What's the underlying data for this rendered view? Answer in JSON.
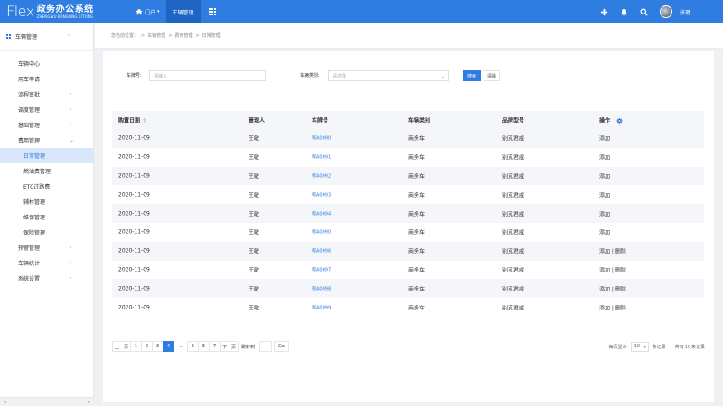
{
  "brand": {
    "mark": "Flex",
    "name_cn": "政务办公系统",
    "name_en": "ZHENGWU BANGONG XITONG"
  },
  "topnav": {
    "portal": "门户",
    "vehicle_mgmt": "车辆管理"
  },
  "user": {
    "name": "张璐"
  },
  "sidebar": {
    "header": "车辆管理",
    "items": [
      {
        "label": "车辆中心",
        "arrow": false,
        "sub": false,
        "active": false
      },
      {
        "label": "用车申请",
        "arrow": false,
        "sub": false,
        "active": false
      },
      {
        "label": "流程审批",
        "arrow": true,
        "sub": false,
        "active": false
      },
      {
        "label": "调度管理",
        "arrow": true,
        "sub": false,
        "active": false
      },
      {
        "label": "基础管理",
        "arrow": true,
        "sub": false,
        "active": false
      },
      {
        "label": "费用管理",
        "arrow": true,
        "expanded": true,
        "sub": false,
        "active": false
      },
      {
        "label": "日常管理",
        "arrow": false,
        "sub": true,
        "active": true
      },
      {
        "label": "燃油费管理",
        "arrow": false,
        "sub": true,
        "active": false
      },
      {
        "label": "ETC过路费",
        "arrow": false,
        "sub": true,
        "active": false
      },
      {
        "label": "辅材管理",
        "arrow": false,
        "sub": true,
        "active": false
      },
      {
        "label": "维保管理",
        "arrow": false,
        "sub": true,
        "active": false
      },
      {
        "label": "保险管理",
        "arrow": false,
        "sub": true,
        "active": false
      },
      {
        "label": "预警管理",
        "arrow": true,
        "sub": false,
        "active": false
      },
      {
        "label": "车辆统计",
        "arrow": true,
        "sub": false,
        "active": false
      },
      {
        "label": "系统设置",
        "arrow": true,
        "sub": false,
        "active": false
      }
    ]
  },
  "breadcrumb": {
    "prefix": "您当前位置：",
    "sep": ">",
    "path": [
      "车辆管理",
      "费用管理",
      "日常管理"
    ]
  },
  "filter": {
    "plate_label": "车牌号:",
    "plate_placeholder": "请输入",
    "type_label": "车辆类别:",
    "type_placeholder": "请选择",
    "search": "搜索",
    "clear": "清除"
  },
  "table": {
    "headers": [
      "购置日期",
      "管理人",
      "车牌号",
      "车辆类别",
      "品牌型号",
      "操作"
    ],
    "rows": [
      {
        "date": "2020-11-09",
        "manager": "王敏",
        "plate": "鄂A0090",
        "type": "商务车",
        "brand": "别克君威",
        "ops": "添加"
      },
      {
        "date": "2020-11-09",
        "manager": "王敏",
        "plate": "鄂A0091",
        "type": "商务车",
        "brand": "别克君威",
        "ops": "添加"
      },
      {
        "date": "2020-11-09",
        "manager": "王敏",
        "plate": "鄂A0092",
        "type": "商务车",
        "brand": "别克君威",
        "ops": "添加"
      },
      {
        "date": "2020-11-09",
        "manager": "王敏",
        "plate": "鄂A0093",
        "type": "商务车",
        "brand": "别克君威",
        "ops": "添加"
      },
      {
        "date": "2020-11-09",
        "manager": "王敏",
        "plate": "鄂A0094",
        "type": "商务车",
        "brand": "别克君威",
        "ops": "添加"
      },
      {
        "date": "2020-11-09",
        "manager": "王敏",
        "plate": "鄂A0090",
        "type": "商务车",
        "brand": "别克君威",
        "ops": "添加"
      },
      {
        "date": "2020-11-09",
        "manager": "王敏",
        "plate": "鄂A0096",
        "type": "商务车",
        "brand": "别克君威",
        "ops": "添加 | 删除"
      },
      {
        "date": "2020-11-09",
        "manager": "王敏",
        "plate": "鄂A0097",
        "type": "商务车",
        "brand": "别克君威",
        "ops": "添加 | 删除"
      },
      {
        "date": "2020-11-09",
        "manager": "王敏",
        "plate": "鄂A0098",
        "type": "商务车",
        "brand": "别克君威",
        "ops": "添加 | 删除"
      },
      {
        "date": "2020-11-09",
        "manager": "王敏",
        "plate": "鄂A0099",
        "type": "商务车",
        "brand": "别克君威",
        "ops": "添加 | 删除"
      }
    ]
  },
  "pager": {
    "prev": "上一页",
    "next": "下一页",
    "goto": "跳转到",
    "go": "Go",
    "pages": [
      "1",
      "2",
      "3",
      "4",
      "...",
      "5",
      "6",
      "7"
    ],
    "current": "4",
    "per_page_label": "每页显示",
    "per_page": "10",
    "per_page_unit": "条记录",
    "total_prefix": "共有",
    "total": "10",
    "total_suffix": "条记录"
  }
}
